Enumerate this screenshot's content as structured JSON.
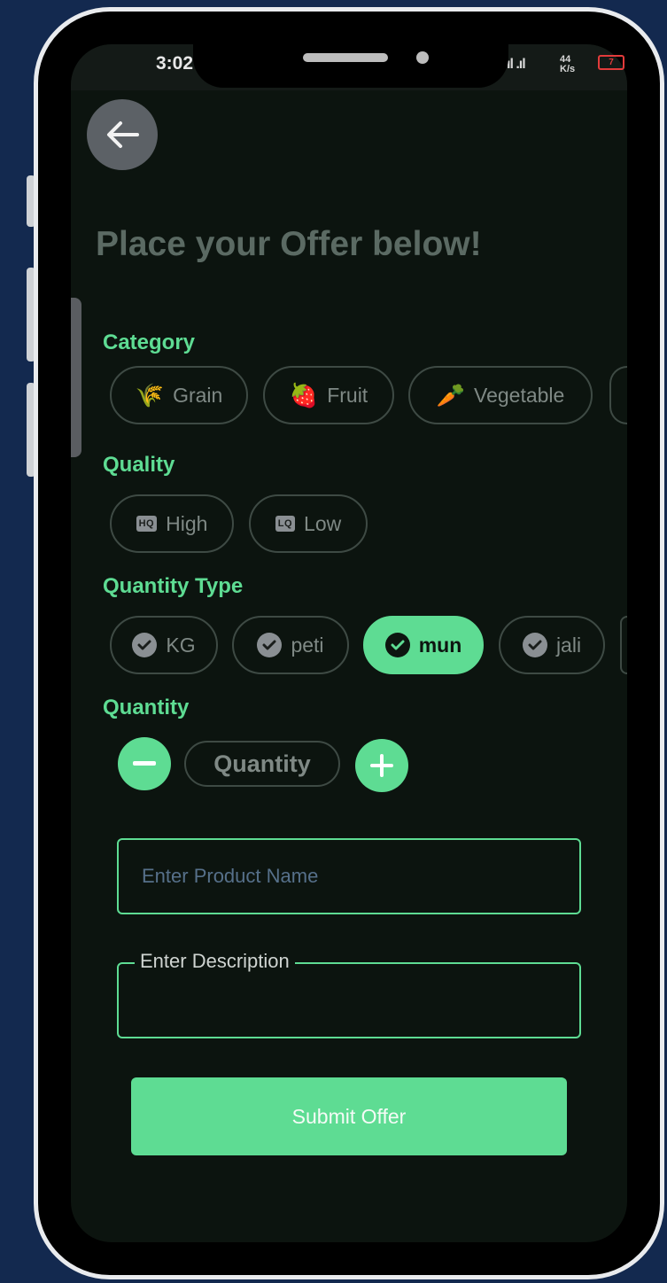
{
  "status_bar": {
    "time": "3:02",
    "signal": "ıl .ıl",
    "network_speed": "44 K/s",
    "battery": "7"
  },
  "page": {
    "title": "Place your Offer below!"
  },
  "sections": {
    "category": "Category",
    "quality": "Quality",
    "quantity_type": "Quantity Type",
    "quantity": "Quantity"
  },
  "category_chips": [
    {
      "label": "Grain",
      "emoji": "🌾"
    },
    {
      "label": "Fruit",
      "emoji": "🍓"
    },
    {
      "label": "Vegetable",
      "emoji": "🥕"
    }
  ],
  "quality_chips": [
    {
      "label": "High",
      "tag": "HQ"
    },
    {
      "label": "Low",
      "tag": "LQ"
    }
  ],
  "quantity_type_chips": [
    {
      "label": "KG",
      "selected": false
    },
    {
      "label": "peti",
      "selected": false
    },
    {
      "label": "mun",
      "selected": true
    },
    {
      "label": "jali",
      "selected": false
    }
  ],
  "quantity_stepper": {
    "value_placeholder": "Quantity"
  },
  "product_name_field": {
    "placeholder": "Enter Product Name",
    "value": ""
  },
  "description_field": {
    "label": "Enter Description",
    "value": ""
  },
  "submit_button": {
    "label": "Submit Offer"
  },
  "colors": {
    "accent": "#5edc93",
    "background": "#0c140f",
    "frame": "#13294f"
  }
}
